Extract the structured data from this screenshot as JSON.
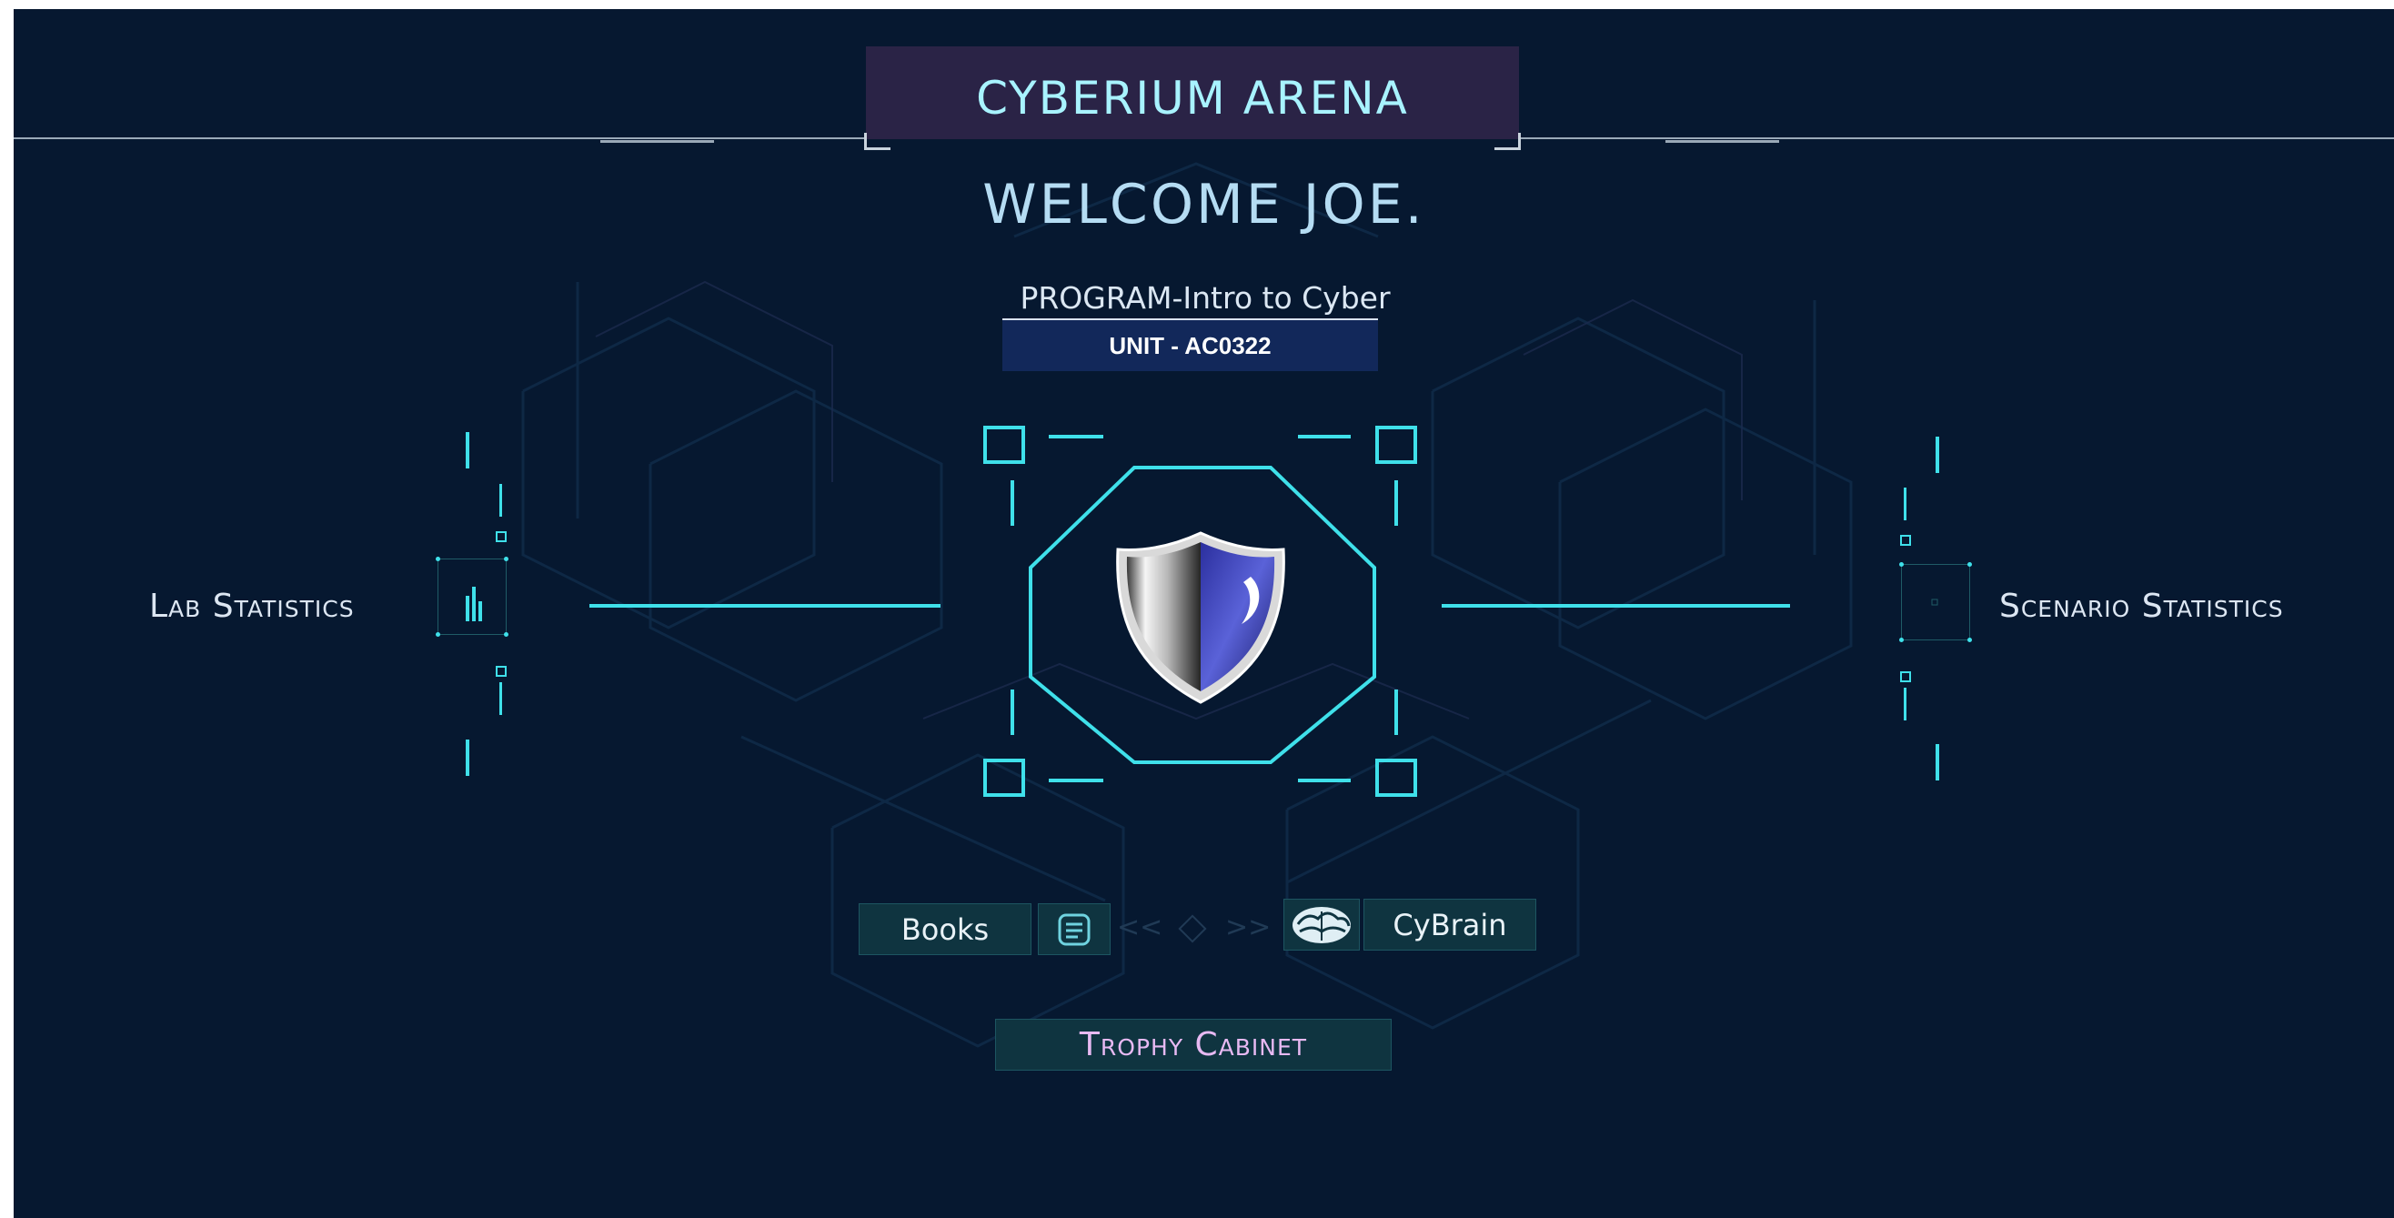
{
  "header": {
    "app_title": "CYBERIUM ARENA"
  },
  "welcome": {
    "text": "WELCOME JOE."
  },
  "program": {
    "label": "PROGRAM-Intro to Cyber",
    "unit": "UNIT - AC0322"
  },
  "stats": {
    "lab_label": "Lab Statistics",
    "scenario_label": "Scenario Statistics"
  },
  "nav": {
    "books_label": "Books",
    "cybrain_label": "CyBrain",
    "prev_arrows": "<<",
    "next_arrows": ">>",
    "trophy_label": "Trophy Cabinet"
  },
  "icons": {
    "lab": "bar-chart-icon",
    "scenario": "stats-box-icon",
    "books": "book-icon",
    "cybrain": "brain-icon",
    "center": "shield-icon"
  },
  "colors": {
    "background": "#061830",
    "accent_cyan": "#3fe0ea",
    "title_plate": "#2a2346",
    "trophy_text": "#e7b9f2"
  }
}
